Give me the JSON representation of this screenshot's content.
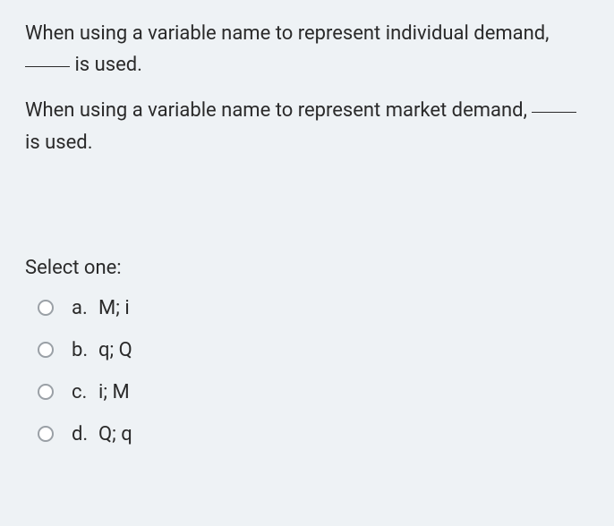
{
  "question": {
    "line1_pre": "When using a variable name to represent individual demand, ",
    "line1_post": " is used.",
    "line2_pre": "When using a variable name to represent market demand, ",
    "line2_post": " is used."
  },
  "select_prompt": "Select one:",
  "options": [
    {
      "letter": "a.",
      "text": "M; i"
    },
    {
      "letter": "b.",
      "text": "q; Q"
    },
    {
      "letter": "c.",
      "text": "i; M"
    },
    {
      "letter": "d.",
      "text": "Q; q"
    }
  ]
}
